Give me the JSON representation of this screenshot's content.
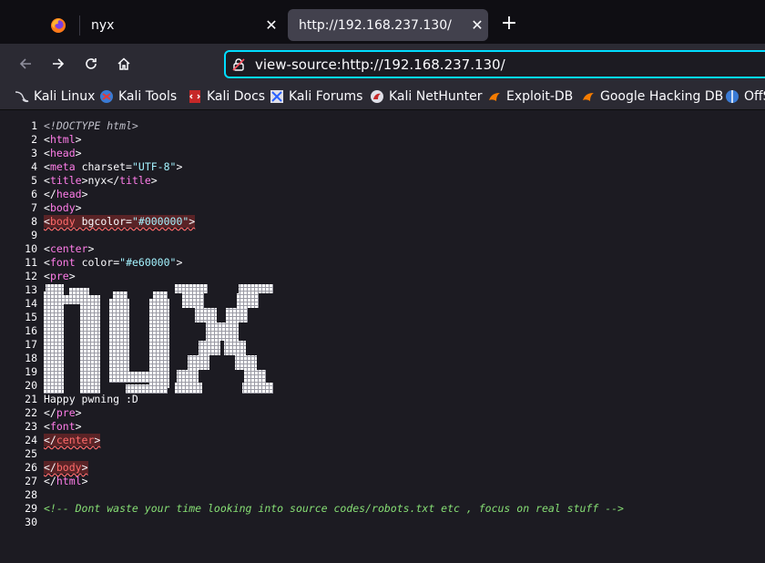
{
  "tabs": [
    {
      "title": "nyx",
      "active": false
    },
    {
      "title": "http://192.168.237.130/",
      "active": true
    }
  ],
  "url": "view-source:http://192.168.237.130/",
  "bookmarks": [
    {
      "label": "Kali Linux",
      "icon": "kali-dragon-icon"
    },
    {
      "label": "Kali Tools",
      "icon": "kali-tools-icon"
    },
    {
      "label": "Kali Docs",
      "icon": "kali-docs-icon"
    },
    {
      "label": "Kali Forums",
      "icon": "kali-forums-icon"
    },
    {
      "label": "Kali NetHunter",
      "icon": "nethunter-icon"
    },
    {
      "label": "Exploit-DB",
      "icon": "exploit-db-icon"
    },
    {
      "label": "Google Hacking DB",
      "icon": "ghdb-icon"
    },
    {
      "label": "OffS",
      "icon": "offsec-icon"
    }
  ],
  "source": {
    "doctype": "<!DOCTYPE html>",
    "t_html": "html",
    "t_head": "head",
    "t_meta": "meta",
    "a_charset": "charset",
    "v_charset": "\"UTF-8\"",
    "t_title": "title",
    "title_text": "nyx",
    "t_body": "body",
    "a_bgcolor": "bgcolor",
    "v_bgcolor": "\"#000000\"",
    "t_center": "center",
    "t_font": "font",
    "a_color": "color",
    "v_color": "\"#e60000\"",
    "t_pre": "pre",
    "happy": "Happy pwning :D",
    "comment": "<!-- Dont waste your time looking into source codes/robots.txt etc , focus on real stuff -->",
    "ascii_text": "nyx",
    "line_numbers": [
      "1",
      "2",
      "3",
      "4",
      "5",
      "6",
      "7",
      "8",
      "9",
      "10",
      "11",
      "12",
      "13",
      "14",
      "15",
      "16",
      "17",
      "18",
      "19",
      "20",
      "21",
      "22",
      "23",
      "24",
      "25",
      "26",
      "27",
      "28",
      "29",
      "30"
    ]
  },
  "colors": {
    "accent": "#00ddff",
    "tag": "#ff7de9",
    "value": "#a4f3ff",
    "comment": "#86de74",
    "error": "#ff6b6b"
  }
}
